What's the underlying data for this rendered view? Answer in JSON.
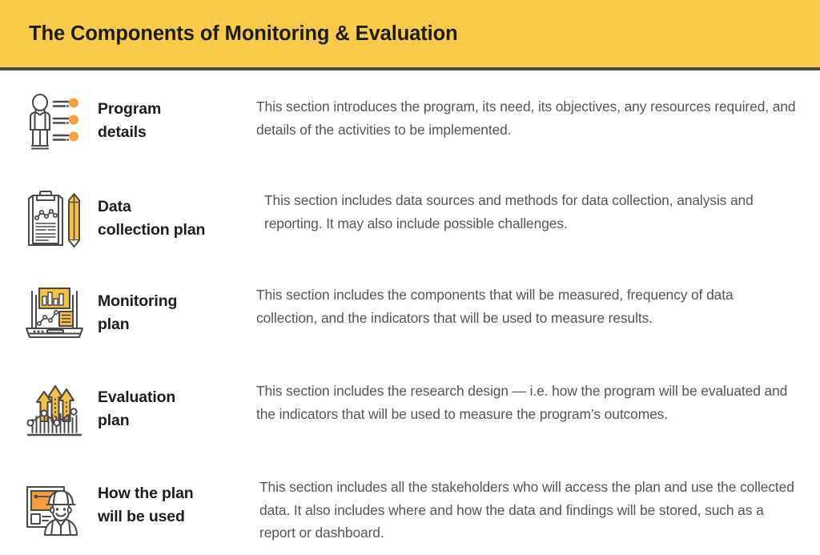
{
  "header": {
    "title": "The Components of Monitoring & Evaluation",
    "background_color": "#F9CB48",
    "border_color": "#4A4A4A",
    "text_color": "#1d1d1d"
  },
  "theme": {
    "yellow": "#F5C243",
    "orange": "#F5A03C",
    "line": "#4A4A4A",
    "body_text": "#555555",
    "heading_text": "#1d1d1d",
    "page_background": "#FFFFFF"
  },
  "rows": [
    {
      "icon": "person-with-checklist-icon",
      "label_line1": "Program",
      "label_line2": "details",
      "label": "Program details",
      "description": "This section introduces the program, its need, its objectives, any resources required, and details of the activities to be implemented."
    },
    {
      "icon": "clipboard-chart-pencil-icon",
      "label_line1": "Data",
      "label_line2": "collection plan",
      "label": "Data collection plan",
      "description": "This section includes data sources and methods for data collection, analysis and reporting. It may also include possible challenges."
    },
    {
      "icon": "laptop-dashboard-icon",
      "label_line1": "Monitoring",
      "label_line2": "plan",
      "label": "Monitoring plan",
      "description": "This section includes the components that will be measured, frequency of data collection, and the indicators that will be used to measure results."
    },
    {
      "icon": "growth-arrows-bar-chart-icon",
      "label_line1": "Evaluation",
      "label_line2": "plan",
      "label": "Evaluation plan",
      "description": "This section includes the research design — i.e. how the program will be evaluated and the indicators that will be used to measure the program’s outcomes."
    },
    {
      "icon": "worker-presentation-board-icon",
      "label_line1": "How the plan",
      "label_line2": "will be used",
      "label": "How the plan will be used",
      "description": "This section includes all the stakeholders who will access the plan and use the collected data. It also includes where and how the data and findings will be stored, such as a report or dashboard."
    }
  ]
}
